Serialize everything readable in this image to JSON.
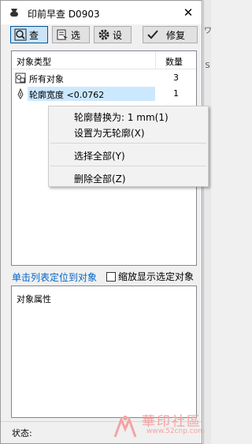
{
  "window": {
    "title": "印前早查 D0903"
  },
  "toolbar": {
    "query_label": "查",
    "select_label": "选",
    "settings_label": "设",
    "fix_label": "修复"
  },
  "list": {
    "col_type": "对象类型",
    "col_count": "数量",
    "rows": [
      {
        "label": "所有对象",
        "count": "3"
      },
      {
        "label": "轮廓宽度 <0.0762",
        "count": "1"
      }
    ]
  },
  "context_menu": {
    "items": [
      "轮廓替换为: 1 mm(1)",
      "设置为无轮廓(X)",
      "选择全部(Y)",
      "删除全部(Z)"
    ]
  },
  "options": {
    "locate_link": "单击列表定位到对象",
    "zoom_checkbox": "缩放显示选定对象"
  },
  "properties": {
    "title": "对象属性"
  },
  "status": {
    "label": "状态:"
  },
  "watermark": {
    "text": "華印社區",
    "url": "www.52cnp.com"
  },
  "colors": {
    "accent": "#0066cc",
    "selection": "#cce8ff",
    "active_button": "#cce4f7"
  }
}
